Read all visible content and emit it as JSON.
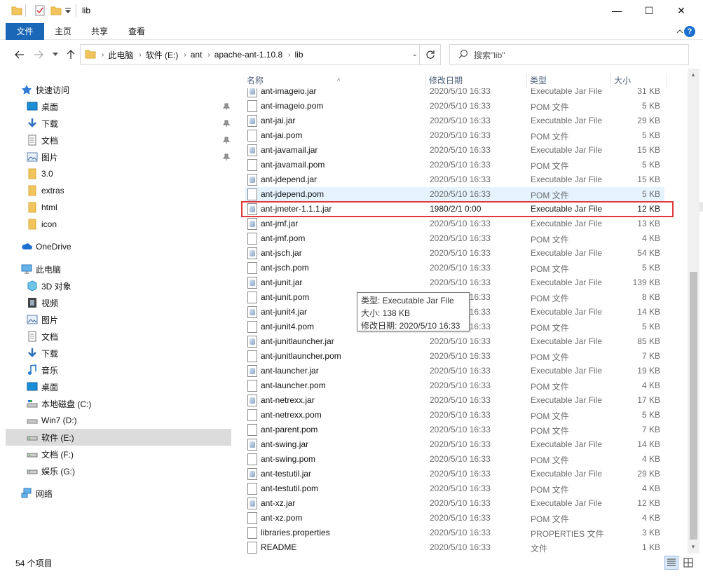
{
  "window": {
    "title": "lib",
    "minimize": "—",
    "maximize": "☐",
    "close": "✕"
  },
  "ribbon": {
    "tabs": [
      "文件",
      "主页",
      "共享",
      "查看"
    ],
    "help": "?"
  },
  "address": {
    "crumbs": [
      "此电脑",
      "软件 (E:)",
      "ant",
      "apache-ant-1.10.8",
      "lib"
    ],
    "search_placeholder": "搜索\"lib\""
  },
  "columns": {
    "name": "名称",
    "date": "修改日期",
    "type": "类型",
    "size": "大小"
  },
  "nav": {
    "quick_access": "快速访问",
    "quick_items": [
      "桌面",
      "下载",
      "文档",
      "图片",
      "3.0",
      "extras",
      "html",
      "icon"
    ],
    "onedrive": "OneDrive",
    "this_pc": "此电脑",
    "pc_items": [
      "3D 对象",
      "视频",
      "图片",
      "文档",
      "下载",
      "音乐",
      "桌面",
      "本地磁盘 (C:)",
      "Win7 (D:)",
      "软件 (E:)",
      "文档 (F:)",
      "娱乐 (G:)"
    ],
    "network": "网络"
  },
  "files": [
    {
      "name": "ant-imageio.jar",
      "date": "2020/5/10 16:33",
      "type": "Executable Jar File",
      "size": "31 KB",
      "kind": "jar"
    },
    {
      "name": "ant-imageio.pom",
      "date": "2020/5/10 16:33",
      "type": "POM 文件",
      "size": "5 KB",
      "kind": "pom"
    },
    {
      "name": "ant-jai.jar",
      "date": "2020/5/10 16:33",
      "type": "Executable Jar File",
      "size": "29 KB",
      "kind": "jar"
    },
    {
      "name": "ant-jai.pom",
      "date": "2020/5/10 16:33",
      "type": "POM 文件",
      "size": "5 KB",
      "kind": "pom"
    },
    {
      "name": "ant-javamail.jar",
      "date": "2020/5/10 16:33",
      "type": "Executable Jar File",
      "size": "15 KB",
      "kind": "jar"
    },
    {
      "name": "ant-javamail.pom",
      "date": "2020/5/10 16:33",
      "type": "POM 文件",
      "size": "5 KB",
      "kind": "pom"
    },
    {
      "name": "ant-jdepend.jar",
      "date": "2020/5/10 16:33",
      "type": "Executable Jar File",
      "size": "15 KB",
      "kind": "jar"
    },
    {
      "name": "ant-jdepend.pom",
      "date": "2020/5/10 16:33",
      "type": "POM 文件",
      "size": "5 KB",
      "kind": "pom"
    },
    {
      "name": "ant-jmeter-1.1.1.jar",
      "date": "1980/2/1 0:00",
      "type": "Executable Jar File",
      "size": "12 KB",
      "kind": "jar"
    },
    {
      "name": "ant-jmf.jar",
      "date": "2020/5/10 16:33",
      "type": "Executable Jar File",
      "size": "13 KB",
      "kind": "jar"
    },
    {
      "name": "ant-jmf.pom",
      "date": "2020/5/10 16:33",
      "type": "POM 文件",
      "size": "4 KB",
      "kind": "pom"
    },
    {
      "name": "ant-jsch.jar",
      "date": "2020/5/10 16:33",
      "type": "Executable Jar File",
      "size": "54 KB",
      "kind": "jar"
    },
    {
      "name": "ant-jsch.pom",
      "date": "2020/5/10 16:33",
      "type": "POM 文件",
      "size": "5 KB",
      "kind": "pom"
    },
    {
      "name": "ant-junit.jar",
      "date": "2020/5/10 16:33",
      "type": "Executable Jar File",
      "size": "139 KB",
      "kind": "jar"
    },
    {
      "name": "ant-junit.pom",
      "date": "2020/5/10 16:33",
      "type": "POM 文件",
      "size": "8 KB",
      "kind": "pom"
    },
    {
      "name": "ant-junit4.jar",
      "date": "2020/5/10 16:33",
      "type": "Executable Jar File",
      "size": "14 KB",
      "kind": "jar"
    },
    {
      "name": "ant-junit4.pom",
      "date": "2020/5/10 16:33",
      "type": "POM 文件",
      "size": "5 KB",
      "kind": "pom"
    },
    {
      "name": "ant-junitlauncher.jar",
      "date": "2020/5/10 16:33",
      "type": "Executable Jar File",
      "size": "85 KB",
      "kind": "jar"
    },
    {
      "name": "ant-junitlauncher.pom",
      "date": "2020/5/10 16:33",
      "type": "POM 文件",
      "size": "7 KB",
      "kind": "pom"
    },
    {
      "name": "ant-launcher.jar",
      "date": "2020/5/10 16:33",
      "type": "Executable Jar File",
      "size": "19 KB",
      "kind": "jar"
    },
    {
      "name": "ant-launcher.pom",
      "date": "2020/5/10 16:33",
      "type": "POM 文件",
      "size": "4 KB",
      "kind": "pom"
    },
    {
      "name": "ant-netrexx.jar",
      "date": "2020/5/10 16:33",
      "type": "Executable Jar File",
      "size": "17 KB",
      "kind": "jar"
    },
    {
      "name": "ant-netrexx.pom",
      "date": "2020/5/10 16:33",
      "type": "POM 文件",
      "size": "5 KB",
      "kind": "pom"
    },
    {
      "name": "ant-parent.pom",
      "date": "2020/5/10 16:33",
      "type": "POM 文件",
      "size": "7 KB",
      "kind": "pom"
    },
    {
      "name": "ant-swing.jar",
      "date": "2020/5/10 16:33",
      "type": "Executable Jar File",
      "size": "14 KB",
      "kind": "jar"
    },
    {
      "name": "ant-swing.pom",
      "date": "2020/5/10 16:33",
      "type": "POM 文件",
      "size": "4 KB",
      "kind": "pom"
    },
    {
      "name": "ant-testutil.jar",
      "date": "2020/5/10 16:33",
      "type": "Executable Jar File",
      "size": "29 KB",
      "kind": "jar"
    },
    {
      "name": "ant-testutil.pom",
      "date": "2020/5/10 16:33",
      "type": "POM 文件",
      "size": "4 KB",
      "kind": "pom"
    },
    {
      "name": "ant-xz.jar",
      "date": "2020/5/10 16:33",
      "type": "Executable Jar File",
      "size": "12 KB",
      "kind": "jar"
    },
    {
      "name": "ant-xz.pom",
      "date": "2020/5/10 16:33",
      "type": "POM 文件",
      "size": "4 KB",
      "kind": "pom"
    },
    {
      "name": "libraries.properties",
      "date": "2020/5/10 16:33",
      "type": "PROPERTIES 文件",
      "size": "3 KB",
      "kind": "file"
    },
    {
      "name": "README",
      "date": "2020/5/10 16:33",
      "type": "文件",
      "size": "1 KB",
      "kind": "file"
    }
  ],
  "tooltip": {
    "type_line": "类型: Executable Jar File",
    "size_line": "大小: 138 KB",
    "date_line": "修改日期: 2020/5/10 16:33"
  },
  "status": {
    "count": "54 个项目"
  },
  "colors": {
    "file_tab": "#1a67b8",
    "highlight_box": "#e0383e",
    "hover_row": "#e5f3ff",
    "selected_nav": "#dcdcdc"
  }
}
